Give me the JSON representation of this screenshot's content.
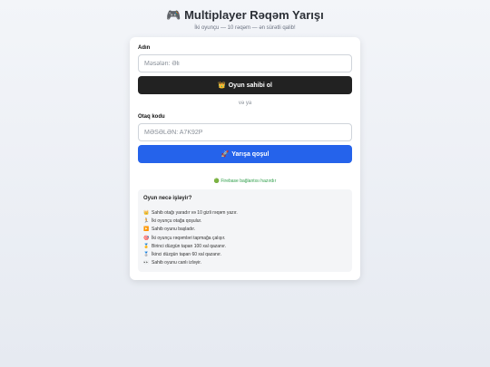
{
  "header": {
    "title_icon": "🎮",
    "title": "Multiplayer Rəqəm Yarışı",
    "subtitle": "İki oyunçu — 10 rəqəm — ən sürətli qalib!"
  },
  "create": {
    "name_label": "Adın",
    "name_placeholder": "Məsələn: Əli",
    "host_icon": "👑",
    "host_button": "Oyun sahibi ol"
  },
  "or_text": "və ya",
  "join": {
    "code_label": "Otaq kodu",
    "code_placeholder": "MƏSƏLƏN: A7K92P",
    "join_icon": "🚀",
    "join_button": "Yarışa qoşul"
  },
  "status": {
    "icon": "🟢",
    "text": "Firebase bağlantısı hazırdır"
  },
  "info": {
    "title": "Oyun necə işləyir?",
    "items": [
      {
        "icon": "👑",
        "text": "Sahib otağı yaradır və 10 gizli rəqəm yazır."
      },
      {
        "icon": "🏃",
        "text": "İki oyunçu otağa qoşulur."
      },
      {
        "icon": "▶️",
        "text": "Sahib oyunu başladır."
      },
      {
        "icon": "🎯",
        "text": "İki oyunçu rəqəmləri tapmağa çalışır."
      },
      {
        "icon": "🥇",
        "text": "Birinci düzgün tapan 100 xal qazanır."
      },
      {
        "icon": "🥈",
        "text": "İkinci düzgün tapan 60 xal qazanır."
      },
      {
        "icon": "👀",
        "text": "Sahib oyunu canlı izləyir."
      }
    ]
  }
}
